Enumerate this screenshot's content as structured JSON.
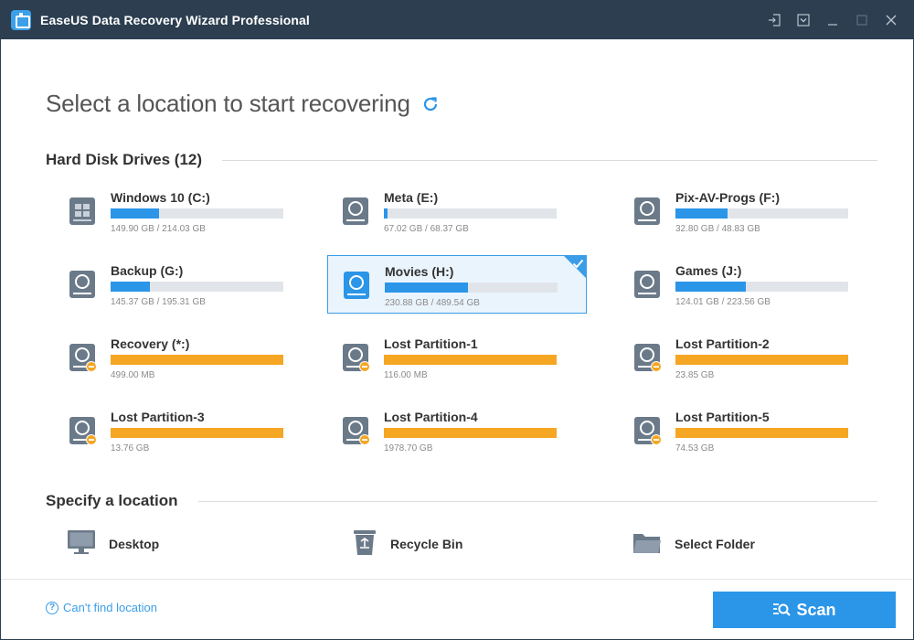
{
  "window": {
    "title": "EaseUS Data Recovery Wizard Professional"
  },
  "heading": {
    "title": "Select a location to start recovering"
  },
  "sections": {
    "drives_label": "Hard Disk Drives (12)",
    "locations_label": "Specify a location"
  },
  "drives": [
    {
      "name": "Windows 10 (C:)",
      "size": "149.90 GB / 214.03 GB",
      "used_fraction": 0.28,
      "kind": "windows",
      "selected": false
    },
    {
      "name": "Meta (E:)",
      "size": "67.02 GB / 68.37 GB",
      "used_fraction": 0.02,
      "kind": "disk",
      "selected": false
    },
    {
      "name": "Pix-AV-Progs (F:)",
      "size": "32.80 GB / 48.83 GB",
      "used_fraction": 0.3,
      "kind": "disk",
      "selected": false
    },
    {
      "name": "Backup (G:)",
      "size": "145.37 GB / 195.31 GB",
      "used_fraction": 0.23,
      "kind": "disk",
      "selected": false
    },
    {
      "name": "Movies (H:)",
      "size": "230.88 GB / 489.54 GB",
      "used_fraction": 0.48,
      "kind": "disk",
      "selected": true
    },
    {
      "name": "Games (J:)",
      "size": "124.01 GB / 223.56 GB",
      "used_fraction": 0.41,
      "kind": "disk",
      "selected": false
    },
    {
      "name": "Recovery (*:)",
      "size": "499.00 MB",
      "used_fraction": 1,
      "kind": "lost",
      "selected": false
    },
    {
      "name": "Lost Partition-1",
      "size": "116.00 MB",
      "used_fraction": 1,
      "kind": "lost",
      "selected": false
    },
    {
      "name": "Lost Partition-2",
      "size": "23.85 GB",
      "used_fraction": 1,
      "kind": "lost",
      "selected": false
    },
    {
      "name": "Lost Partition-3",
      "size": "13.76 GB",
      "used_fraction": 1,
      "kind": "lost",
      "selected": false
    },
    {
      "name": "Lost Partition-4",
      "size": "1978.70 GB",
      "used_fraction": 1,
      "kind": "lost",
      "selected": false
    },
    {
      "name": "Lost Partition-5",
      "size": "74.53 GB",
      "used_fraction": 1,
      "kind": "lost",
      "selected": false
    }
  ],
  "locations": [
    {
      "label": "Desktop",
      "icon": "monitor-icon"
    },
    {
      "label": "Recycle Bin",
      "icon": "recycle-bin-icon"
    },
    {
      "label": "Select Folder",
      "icon": "folder-icon"
    }
  ],
  "footer": {
    "help_link": "Can't find location",
    "scan_label": "Scan"
  },
  "colors": {
    "titlebar": "#2c3e50",
    "accent": "#2b95e8",
    "lost_partition": "#f5a623"
  }
}
